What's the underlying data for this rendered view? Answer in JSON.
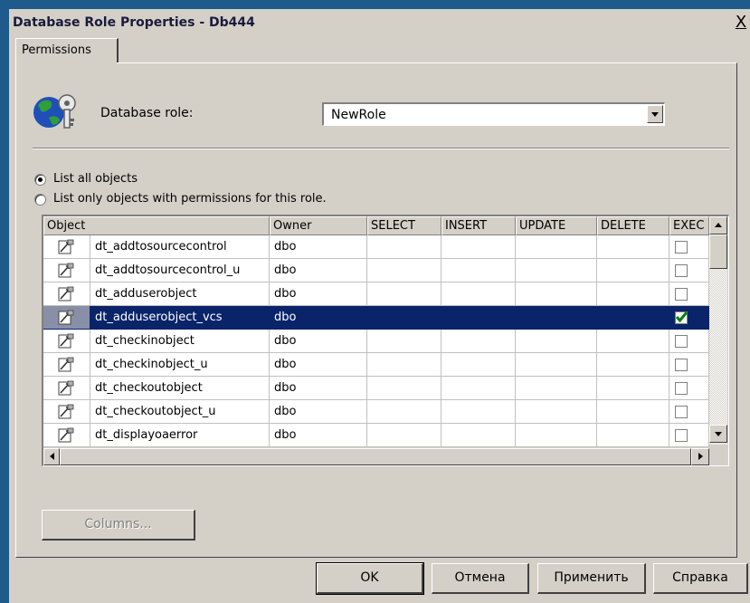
{
  "window": {
    "title": "Database Role Properties - Db444",
    "close_label": "X"
  },
  "tabs": [
    {
      "label": "Permissions"
    }
  ],
  "role": {
    "label": "Database role:",
    "value": "NewRole"
  },
  "radios": [
    {
      "label": "List all objects",
      "checked": true
    },
    {
      "label": "List only objects with permissions for this role.",
      "checked": false
    }
  ],
  "grid": {
    "columns": [
      "Object",
      "Owner",
      "SELECT",
      "INSERT",
      "UPDATE",
      "DELETE",
      "EXEC"
    ],
    "rows": [
      {
        "object": "dt_addtosourcecontrol",
        "owner": "dbo",
        "exec": false
      },
      {
        "object": "dt_addtosourcecontrol_u",
        "owner": "dbo",
        "exec": false
      },
      {
        "object": "dt_adduserobject",
        "owner": "dbo",
        "exec": false
      },
      {
        "object": "dt_adduserobject_vcs",
        "owner": "dbo",
        "exec": true,
        "selected": true
      },
      {
        "object": "dt_checkinobject",
        "owner": "dbo",
        "exec": false
      },
      {
        "object": "dt_checkinobject_u",
        "owner": "dbo",
        "exec": false
      },
      {
        "object": "dt_checkoutobject",
        "owner": "dbo",
        "exec": false
      },
      {
        "object": "dt_checkoutobject_u",
        "owner": "dbo",
        "exec": false
      },
      {
        "object": "dt_displayoaerror",
        "owner": "dbo",
        "exec": false
      }
    ]
  },
  "buttons": {
    "columns": "Columns...",
    "ok": "OK",
    "cancel": "Отмена",
    "apply": "Применить",
    "help": "Справка"
  },
  "colors": {
    "selection": "#0a246a",
    "face": "#d4d0c8",
    "background": "#1e5a8c",
    "check": "#008000"
  }
}
